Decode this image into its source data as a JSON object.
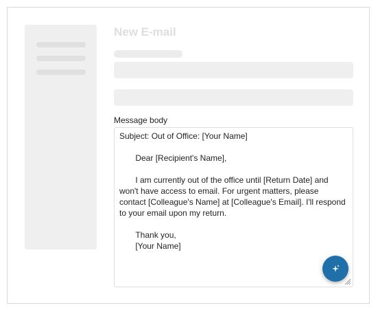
{
  "compose": {
    "title": "New E-mail",
    "body_label": "Message body",
    "body_text": "Subject: Out of Office: [Your Name]\n\n       Dear [Recipient's Name],\n\n       I am currently out of the office until [Return Date] and won't have access to email. For urgent matters, please contact [Colleague's Name] at [Colleague's Email]. I'll respond to your email upon my return.\n\n       Thank you,\n       [Your Name]"
  },
  "icons": {
    "ai_button": "sparkle-icon",
    "resize": "resize-grip-icon"
  },
  "colors": {
    "accent": "#1f6fa8",
    "placeholder": "#efefef",
    "title_faded": "#dedede"
  }
}
